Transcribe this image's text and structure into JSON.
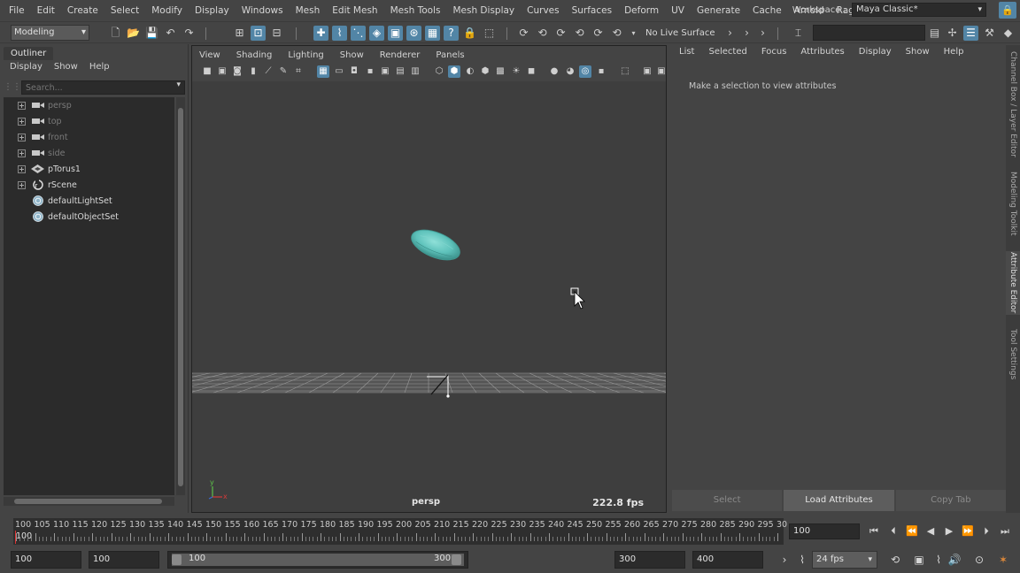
{
  "menubar": {
    "items": [
      "File",
      "Edit",
      "Create",
      "Select",
      "Modify",
      "Display",
      "Windows",
      "Mesh",
      "Edit Mesh",
      "Mesh Tools",
      "Mesh Display",
      "Curves",
      "Surfaces",
      "Deform",
      "UV",
      "Generate",
      "Cache",
      "Arnold",
      "Ragdoll"
    ],
    "workspace_label": "Workspace :",
    "workspace_value": "Maya Classic*"
  },
  "statusline": {
    "menu_set": "Modeling",
    "live_surface": "No Live Surface"
  },
  "outliner": {
    "tab": "Outliner",
    "menu": [
      "Display",
      "Show",
      "Help"
    ],
    "search_placeholder": "Search...",
    "items": [
      {
        "label": "persp",
        "icon": "camera-icon",
        "expandable": true,
        "dim": true
      },
      {
        "label": "top",
        "icon": "camera-icon",
        "expandable": true,
        "dim": true
      },
      {
        "label": "front",
        "icon": "camera-icon",
        "expandable": true,
        "dim": true
      },
      {
        "label": "side",
        "icon": "camera-icon",
        "expandable": true,
        "dim": true
      },
      {
        "label": "pTorus1",
        "icon": "mesh-icon",
        "expandable": true,
        "dim": false
      },
      {
        "label": "rScene",
        "icon": "rscene-icon",
        "expandable": true,
        "dim": false
      },
      {
        "label": "defaultLightSet",
        "icon": "set-icon",
        "expandable": false,
        "dim": false
      },
      {
        "label": "defaultObjectSet",
        "icon": "set-icon",
        "expandable": false,
        "dim": false
      }
    ]
  },
  "viewport": {
    "menu": [
      "View",
      "Shading",
      "Lighting",
      "Show",
      "Renderer",
      "Panels"
    ],
    "camera": "persp",
    "fps": "222.8 fps",
    "axis_y": "y",
    "axis_x": "x"
  },
  "attribute_editor": {
    "menu": [
      "List",
      "Selected",
      "Focus",
      "Attributes",
      "Display",
      "Show",
      "Help"
    ],
    "message": "Make a selection to view attributes",
    "buttons": {
      "select": "Select",
      "load": "Load Attributes",
      "copy": "Copy Tab"
    }
  },
  "side_tabs": [
    "Channel Box / Layer Editor",
    "Modeling Toolkit",
    "Attribute Editor",
    "Tool Settings"
  ],
  "timeslider": {
    "tick_labels": [
      "100",
      "105",
      "110",
      "115",
      "120",
      "125",
      "130",
      "135",
      "140",
      "145",
      "150",
      "155",
      "160",
      "165",
      "170",
      "175",
      "180",
      "185",
      "190",
      "195",
      "200",
      "205",
      "210",
      "215",
      "220",
      "225",
      "230",
      "235",
      "240",
      "245",
      "250",
      "255",
      "260",
      "265",
      "270",
      "275",
      "280",
      "285",
      "290",
      "295",
      "30"
    ],
    "current_frame": "100",
    "current_field": "100"
  },
  "rangeslider": {
    "anim_start": "100",
    "playback_start": "100",
    "range_start": "100",
    "range_end": "300",
    "playback_end": "300",
    "anim_end": "400",
    "fps": "24 fps"
  },
  "colors": {
    "accent": "#5285a6",
    "torus": "#5ec2bb",
    "background": "#444444"
  }
}
